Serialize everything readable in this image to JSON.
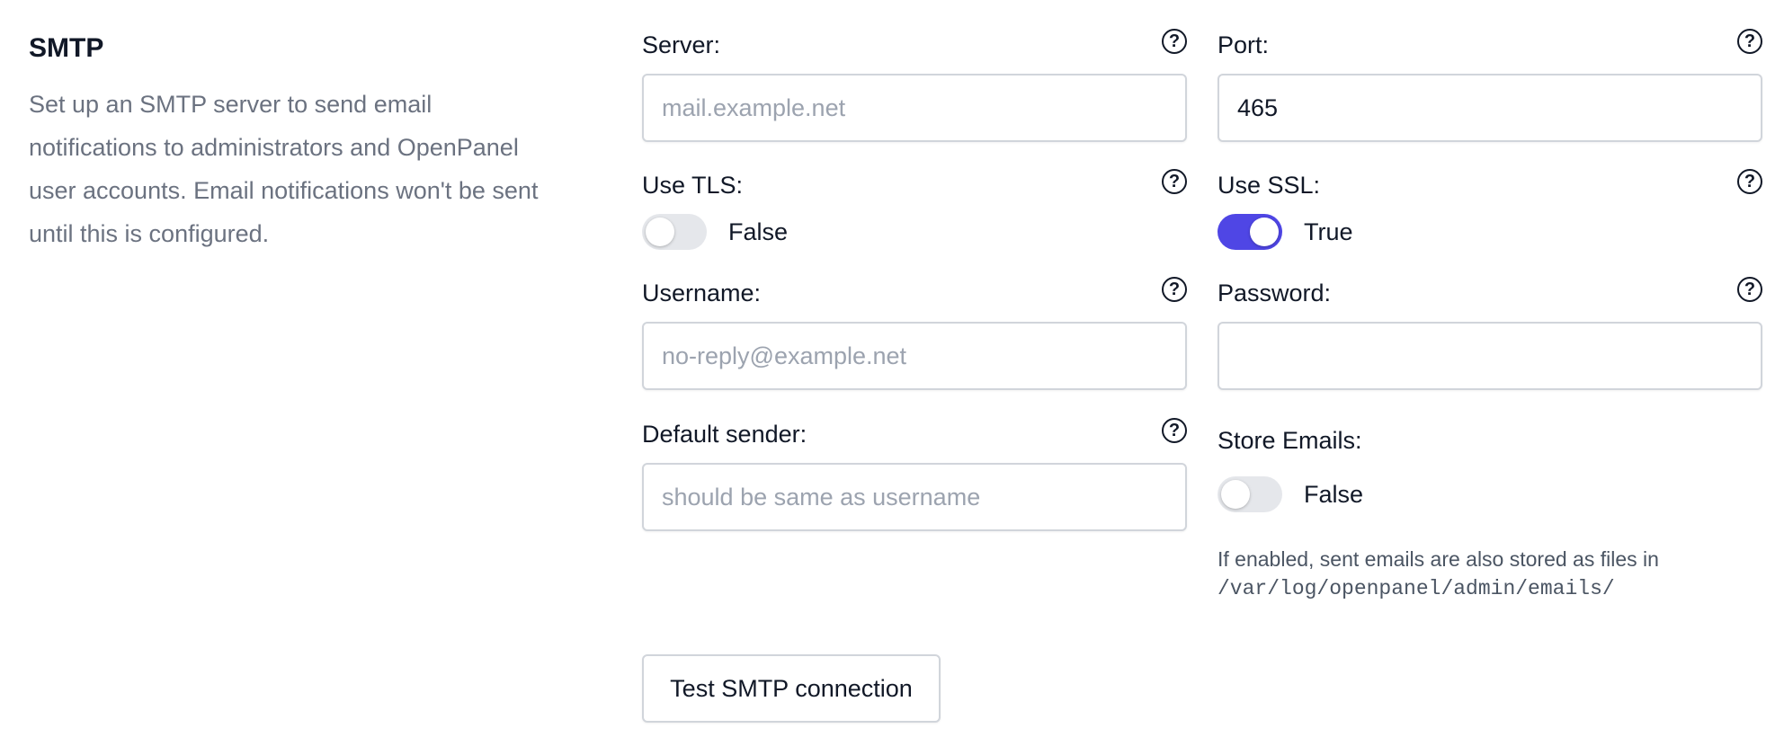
{
  "section": {
    "title": "SMTP",
    "description": "Set up an SMTP server to send email notifications to administrators and OpenPanel user accounts. Email notifications won't be sent until this is configured."
  },
  "help_glyph": "?",
  "fields": {
    "server": {
      "label": "Server:",
      "value": "",
      "placeholder": "mail.example.net"
    },
    "port": {
      "label": "Port:",
      "value": "465",
      "placeholder": ""
    },
    "use_tls": {
      "label": "Use TLS:",
      "state": false,
      "state_label": "False"
    },
    "use_ssl": {
      "label": "Use SSL:",
      "state": true,
      "state_label": "True"
    },
    "username": {
      "label": "Username:",
      "value": "",
      "placeholder": "no-reply@example.net"
    },
    "password": {
      "label": "Password:",
      "value": "",
      "placeholder": ""
    },
    "default_sender": {
      "label": "Default sender:",
      "value": "",
      "placeholder": "should be same as username"
    },
    "store_emails": {
      "label": "Store Emails:",
      "state": false,
      "state_label": "False",
      "hint_text": "If enabled, sent emails are also stored as files in",
      "hint_path": "/var/log/openpanel/admin/emails/"
    }
  },
  "actions": {
    "test_label": "Test SMTP connection"
  },
  "colors": {
    "accent": "#4f46e5",
    "toggle_off": "#e5e7eb",
    "muted_text": "#6b7280"
  }
}
